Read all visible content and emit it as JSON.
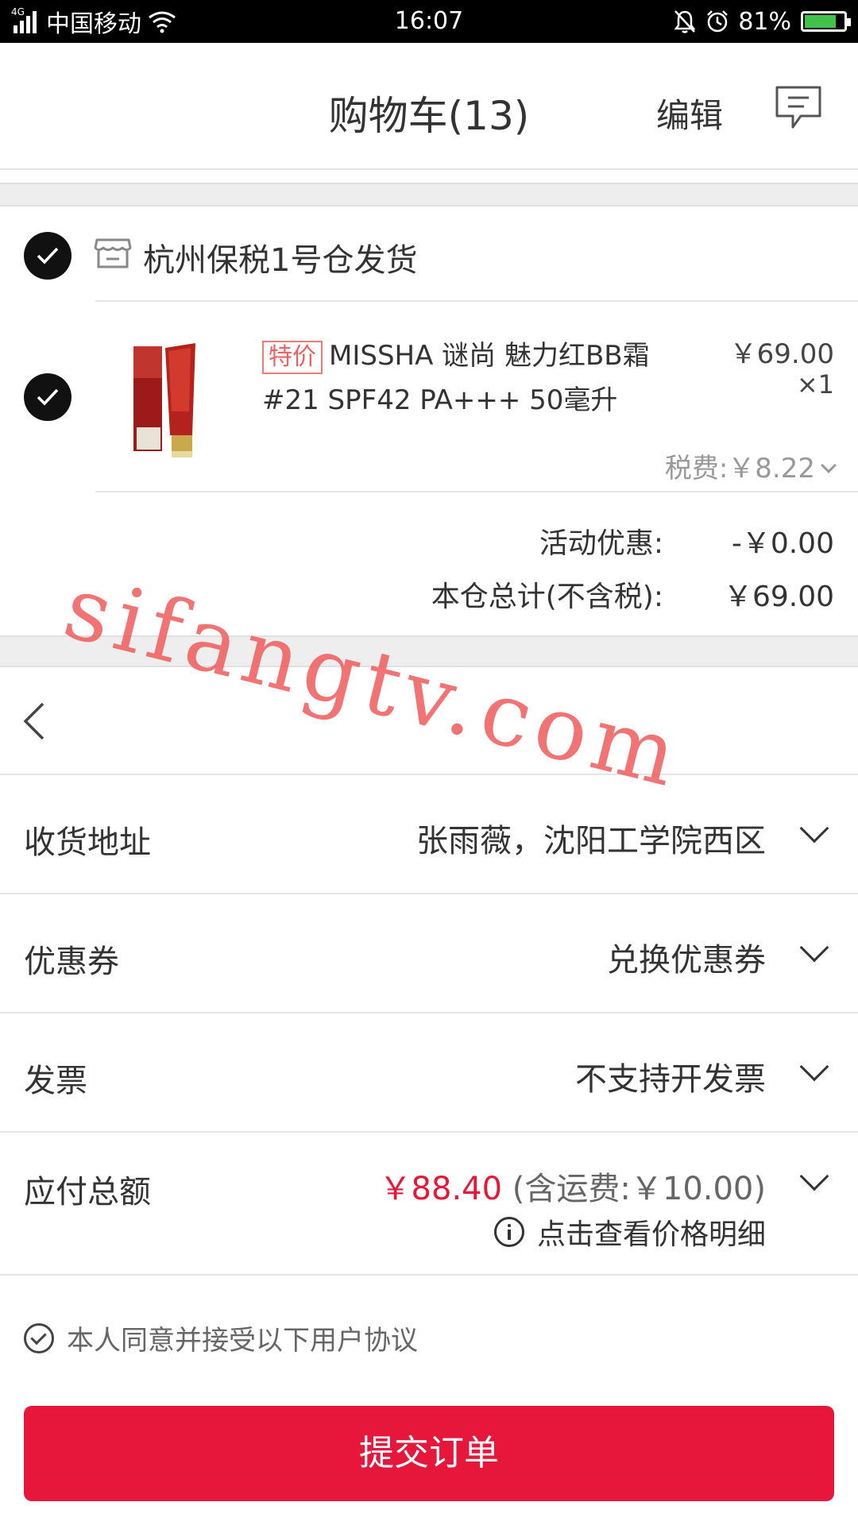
{
  "status_bar": {
    "network": "4G",
    "carrier": "中国移动",
    "time": "16:07",
    "battery": "81%",
    "battery_level": 0.81,
    "icons": [
      "signal-icon",
      "wifi-icon",
      "mute-bell-icon",
      "alarm-icon",
      "battery-icon"
    ]
  },
  "header": {
    "title": "购物车(13)",
    "edit_label": "编辑",
    "message_icon": "message-icon"
  },
  "warehouse": {
    "name": "杭州保税1号仓发货",
    "store_icon": "store-icon",
    "product": {
      "tag": "特价",
      "name": "MISSHA 谜尚 魅力红BB霜 #21 SPF42 PA+++ 50毫升",
      "price": "￥69.00",
      "quantity": "×1",
      "tax": "税费:￥8.22"
    },
    "promo_label": "活动优惠:",
    "promo_value": "-￥0.00",
    "subtotal_label": "本仓总计(不含税):",
    "subtotal_value": "￥69.00"
  },
  "order": {
    "address_label": "收货地址",
    "address_value": "张雨薇，沈阳工学院西区",
    "coupon_label": "优惠券",
    "coupon_value": "兑换优惠券",
    "invoice_label": "发票",
    "invoice_value": "不支持开发票",
    "total_label": "应付总额",
    "total_price": "￥88.40",
    "total_shipping": " (含运费:￥10.00)",
    "price_detail_link": "点击查看价格明细",
    "agreement": "本人同意并接受以下用户协议",
    "submit_label": "提交订单"
  },
  "watermark": "sifangtv.com",
  "colors": {
    "accent": "#e6173a",
    "tag": "#f06060",
    "watermark": "#f05a5a"
  }
}
